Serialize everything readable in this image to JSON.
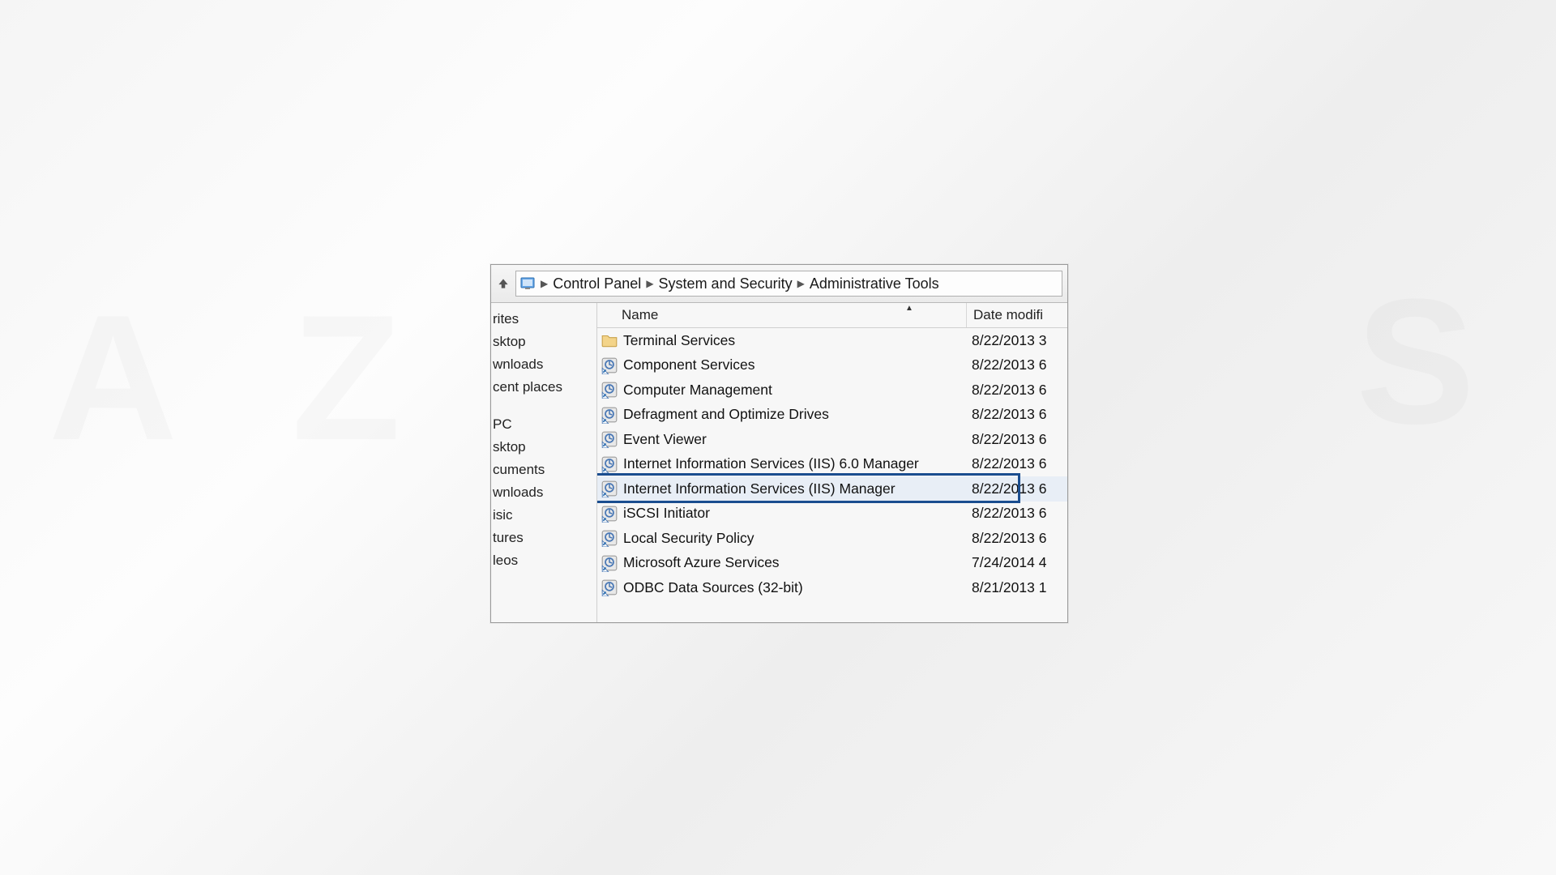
{
  "breadcrumb": [
    "Control Panel",
    "System and Security",
    "Administrative Tools"
  ],
  "columns": {
    "name": "Name",
    "date": "Date modifi"
  },
  "sidebar": [
    "rites",
    "sktop",
    "wnloads",
    "cent places",
    "PC",
    "sktop",
    "cuments",
    "wnloads",
    "isic",
    "tures",
    "leos"
  ],
  "items": [
    {
      "name": "Terminal Services",
      "date": "8/22/2013 3",
      "icon": "folder",
      "highlight": false
    },
    {
      "name": "Component Services",
      "date": "8/22/2013 6",
      "icon": "shortcut",
      "highlight": false
    },
    {
      "name": "Computer Management",
      "date": "8/22/2013 6",
      "icon": "shortcut",
      "highlight": false
    },
    {
      "name": "Defragment and Optimize Drives",
      "date": "8/22/2013 6",
      "icon": "shortcut",
      "highlight": false
    },
    {
      "name": "Event Viewer",
      "date": "8/22/2013 6",
      "icon": "shortcut",
      "highlight": false
    },
    {
      "name": "Internet Information Services (IIS) 6.0 Manager",
      "date": "8/22/2013 6",
      "icon": "shortcut",
      "highlight": false
    },
    {
      "name": "Internet Information Services (IIS) Manager",
      "date": "8/22/2013 6",
      "icon": "shortcut",
      "highlight": true
    },
    {
      "name": "iSCSI Initiator",
      "date": "8/22/2013 6",
      "icon": "shortcut",
      "highlight": false
    },
    {
      "name": "Local Security Policy",
      "date": "8/22/2013 6",
      "icon": "shortcut",
      "highlight": false
    },
    {
      "name": "Microsoft Azure Services",
      "date": "7/24/2014 4",
      "icon": "shortcut",
      "highlight": false
    },
    {
      "name": "ODBC Data Sources (32-bit)",
      "date": "8/21/2013 1",
      "icon": "shortcut",
      "highlight": false
    }
  ],
  "icons": {
    "folder": "folder-icon",
    "shortcut": "shortcut-icon"
  },
  "colors": {
    "highlight_border": "#1a4d8f",
    "highlight_fill": "#e8eef6"
  }
}
